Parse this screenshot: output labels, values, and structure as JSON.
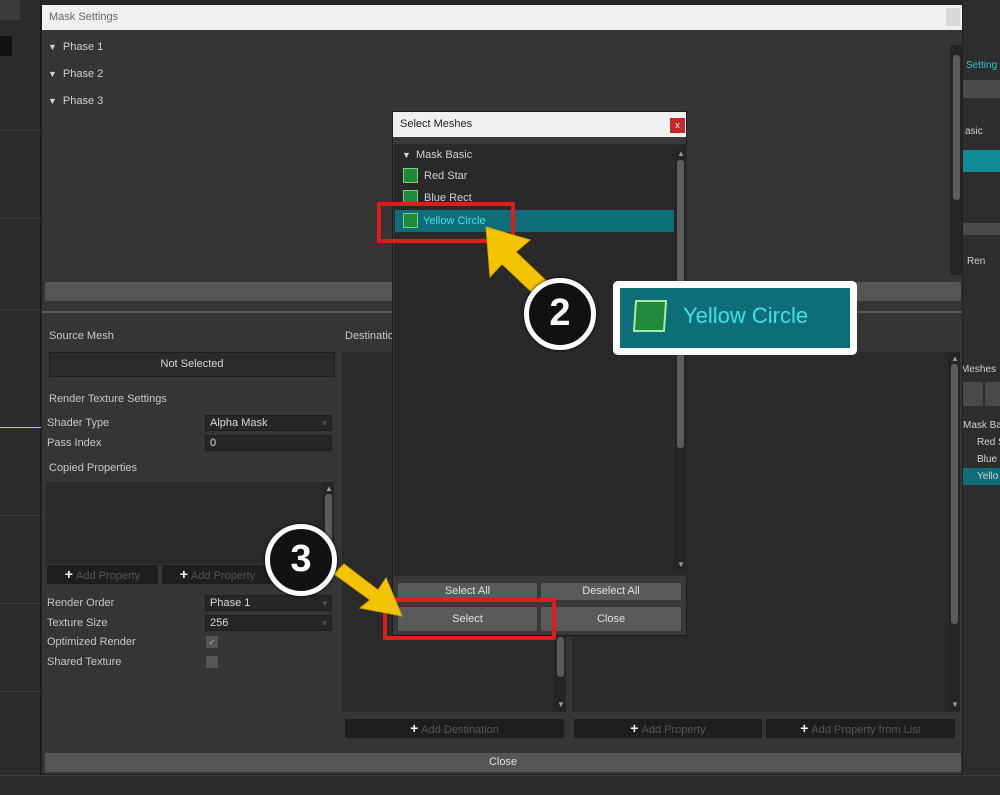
{
  "window": {
    "title": "Mask Settings",
    "phases": [
      "Phase 1",
      "Phase 2",
      "Phase 3"
    ],
    "close_label": "Close"
  },
  "source": {
    "section_label": "Source Mesh",
    "mesh_value": "Not Selected",
    "render_texture_label": "Render Texture Settings",
    "shader_type_label": "Shader Type",
    "shader_type_value": "Alpha Mask",
    "pass_index_label": "Pass Index",
    "pass_index_value": "0",
    "copied_properties_label": "Copied Properties",
    "add_property_1": "Add Property",
    "add_property_2": "Add Property",
    "render_order_label": "Render Order",
    "render_order_value": "Phase 1",
    "texture_size_label": "Texture Size",
    "texture_size_value": "256",
    "optimized_render_label": "Optimized Render",
    "optimized_render_checked": true,
    "shared_texture_label": "Shared Texture",
    "shared_texture_checked": false
  },
  "destination": {
    "section_label": "Destination",
    "add_destination": "Add Destination",
    "add_property": "Add Property",
    "add_property_from_list": "Add Property from List"
  },
  "dialog": {
    "title": "Select Meshes",
    "close_x": "x",
    "group_label": "Mask Basic",
    "meshes": [
      {
        "label": "Red Star",
        "selected": false
      },
      {
        "label": "Blue Rect",
        "selected": false
      },
      {
        "label": "Yellow Circle",
        "selected": true
      }
    ],
    "select_all": "Select All",
    "deselect_all": "Deselect All",
    "select": "Select",
    "close": "Close"
  },
  "callouts": {
    "step2": "2",
    "step3": "3",
    "zoom_label": "Yellow Circle"
  },
  "right_panel": {
    "settings_label": "Setting",
    "basic_label": "asic",
    "remove_label": "Ren",
    "meshes_label": "Meshes",
    "items": [
      "Mask Ba",
      "Red S",
      "Blue",
      "Yello"
    ]
  },
  "colors": {
    "selection": "#0d6e79",
    "selection_text": "#3de0e6",
    "highlight": "#e01b1b",
    "arrow": "#f5c400"
  }
}
